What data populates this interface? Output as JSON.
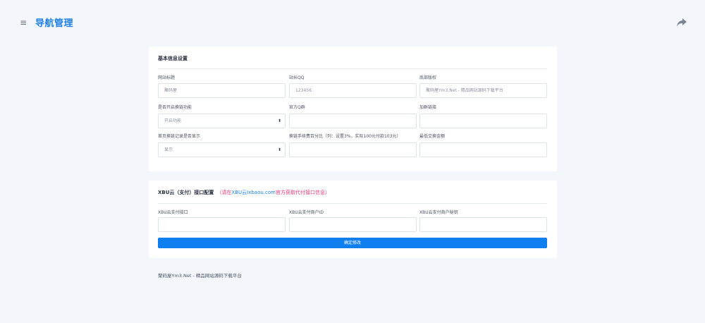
{
  "header": {
    "title": "导航管理",
    "menu_icon": "hamburger-icon",
    "share_icon": "share-icon"
  },
  "basic_settings": {
    "title": "基本信息设置",
    "fields": [
      {
        "label": "网站标题",
        "value": "聚码屋",
        "type": "text"
      },
      {
        "label": "站长QQ",
        "value": "123456",
        "type": "text"
      },
      {
        "label": "底部版权",
        "value": "聚码屋Ym3.Net - 精品网站源码下载平台",
        "type": "text"
      },
      {
        "label": "是否开启换链功能",
        "value": "开启功能",
        "type": "select"
      },
      {
        "label": "官方Q群",
        "value": "",
        "type": "text"
      },
      {
        "label": "加群链接",
        "value": "",
        "type": "text"
      },
      {
        "label": "首页换链记录是否显示",
        "value": "显示",
        "type": "select"
      },
      {
        "label": "换链手续费百分比（列：设置3%，实际100元付款103元）",
        "value": "",
        "type": "text"
      },
      {
        "label": "最低交换金额",
        "value": "",
        "type": "text"
      }
    ]
  },
  "pay_settings": {
    "title": "XBU云（支付）接口配置",
    "note_prefix": "（请在",
    "note_link": "XBU云Ixbaou.com",
    "note_suffix": "官方获取代付接口信息）",
    "fields": [
      {
        "label": "XBU云支付接口",
        "value": ""
      },
      {
        "label": "XBU云支付商户ID",
        "value": ""
      },
      {
        "label": "XBU云支付商户秘钥",
        "value": ""
      }
    ],
    "submit_label": "确定修改"
  },
  "footer": {
    "text": "聚码屋Ym3.Net - 精品网站源码下载平台"
  },
  "colors": {
    "accent": "#1e7fe6",
    "button": "#0f7ff0",
    "note": "#e0387c",
    "background": "#f3f6fb"
  }
}
